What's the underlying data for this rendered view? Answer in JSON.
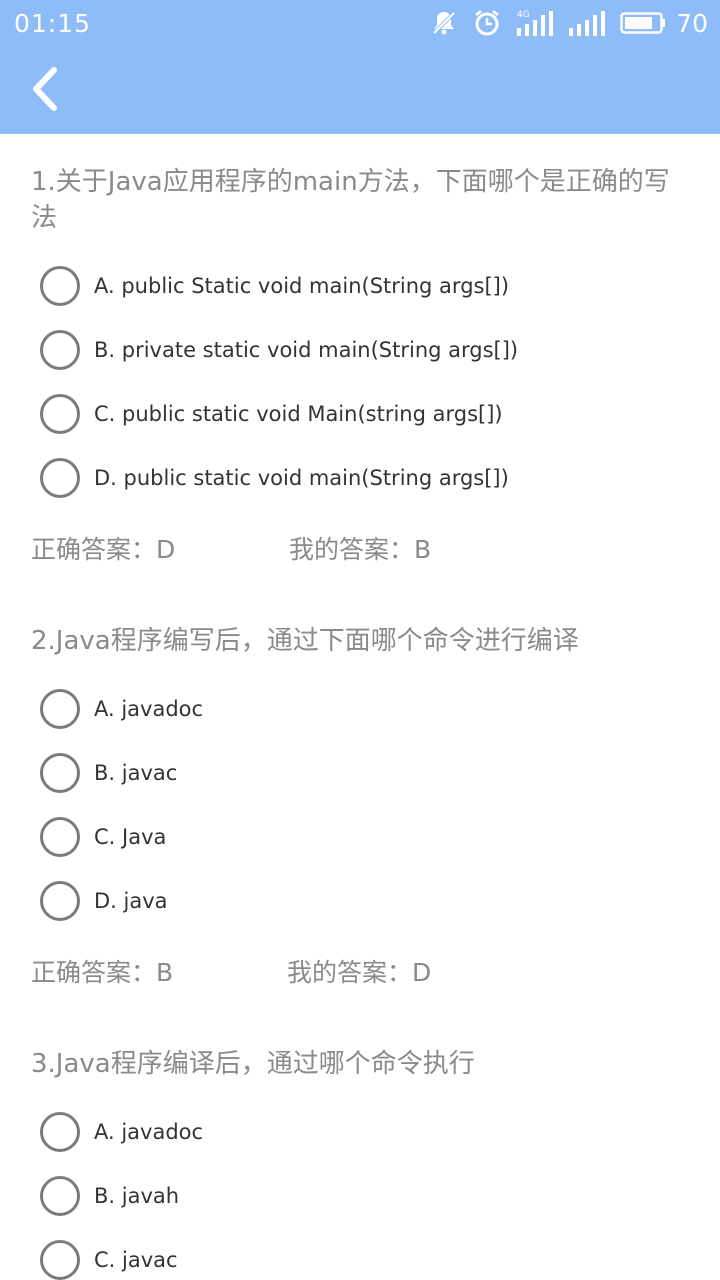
{
  "status_bar": {
    "time": "01:15",
    "network_label": "4G",
    "battery_percent": "70",
    "icons": [
      "bell-muted-icon",
      "alarm-clock-icon",
      "signal-4g-icon",
      "signal-icon",
      "battery-icon"
    ]
  },
  "header": {
    "background_color": "#8dbcf8",
    "back_icon": "chevron-left-icon"
  },
  "questions": [
    {
      "title": "1.关于Java应用程序的main方法，下面哪个是正确的写法",
      "options": [
        "A. public Static void main(String args[])",
        "B. private static void main(String args[])",
        "C. public static void Main(string args[])",
        "D. public static void main(String args[])"
      ],
      "correct_answer": "正确答案：D",
      "my_answer": "我的答案：B"
    },
    {
      "title": "2.Java程序编写后，通过下面哪个命令进行编译",
      "options": [
        "A. javadoc",
        "B. javac",
        "C. Java",
        "D. java"
      ],
      "correct_answer": "正确答案：B",
      "my_answer": "我的答案：D"
    },
    {
      "title": "3.Java程序编译后，通过哪个命令执行",
      "options": [
        "A. javadoc",
        "B. javah",
        "C. javac"
      ]
    }
  ]
}
